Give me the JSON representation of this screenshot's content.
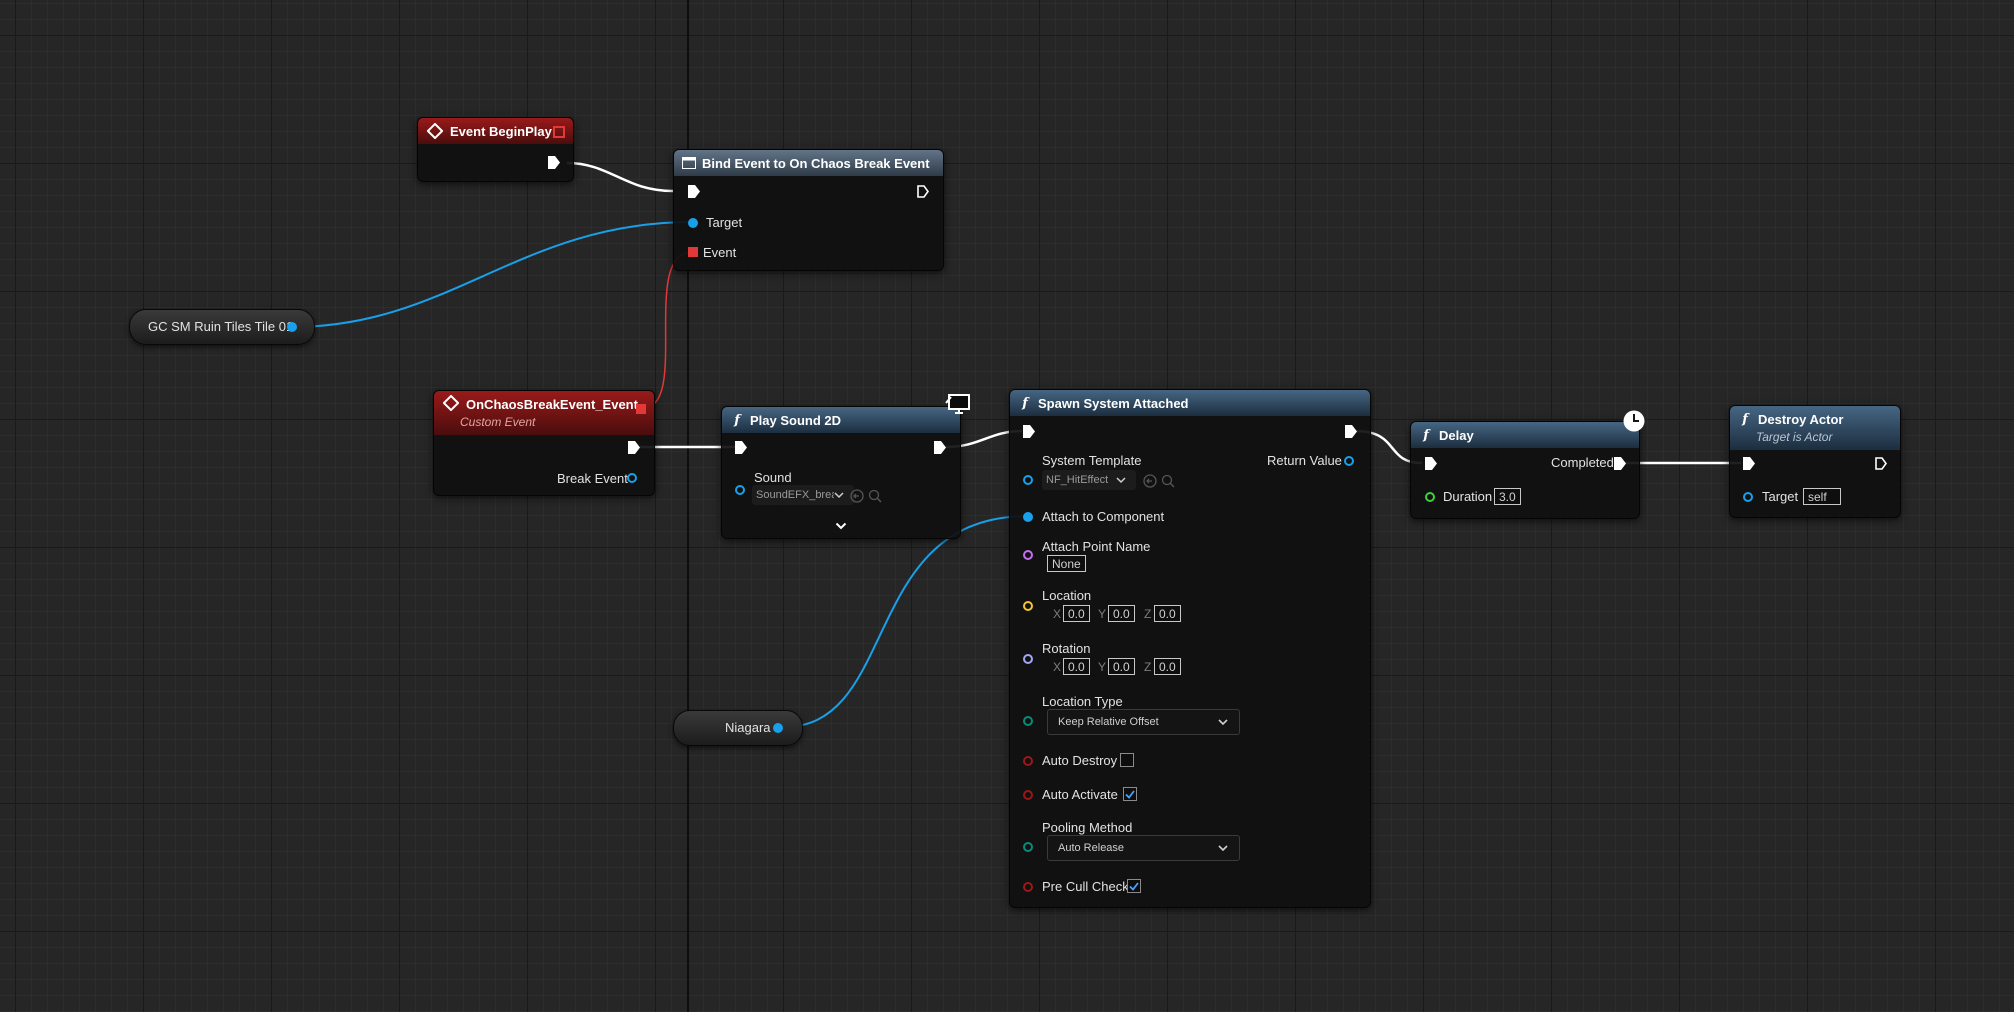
{
  "colors": {
    "exec": "#ffffff",
    "object_pin": "#19a0ea",
    "delegate": "#e23838",
    "name_pin": "#c36ff0",
    "vector_pin": "#f4c431",
    "rotator_pin": "#a4a7f5",
    "enum_pin": "#0a8a78",
    "bool_pin": "#9e1616",
    "float_pin": "#3ed03b"
  },
  "nodes": {
    "begin_play": {
      "title": "Event BeginPlay"
    },
    "bind_event": {
      "title": "Bind Event to On Chaos Break Event",
      "pins": {
        "target": "Target",
        "event": "Event"
      }
    },
    "gc_tile": {
      "label": "GC SM Ruin Tiles Tile 01"
    },
    "chaos_event": {
      "title": "OnChaosBreakEvent_Event",
      "subtitle": "Custom Event",
      "pins": {
        "break_event": "Break Event"
      }
    },
    "play_sound": {
      "title": "Play Sound 2D",
      "pins": {
        "sound": "Sound"
      },
      "sound_value": "SoundEFX_brea"
    },
    "spawn_system": {
      "title": "Spawn System Attached",
      "pins": {
        "system_template": "System Template",
        "return_value": "Return Value",
        "attach_to_component": "Attach to Component",
        "attach_point_name": "Attach Point Name",
        "location": "Location",
        "rotation": "Rotation",
        "location_type": "Location Type",
        "auto_destroy": "Auto Destroy",
        "auto_activate": "Auto Activate",
        "pooling_method": "Pooling Method",
        "pre_cull_check": "Pre Cull Check"
      },
      "values": {
        "system_template": "NF_HitEffect",
        "attach_point_name": "None",
        "location": {
          "x": "0.0",
          "y": "0.0",
          "z": "0.0"
        },
        "rotation": {
          "x": "0.0",
          "y": "0.0",
          "z": "0.0"
        },
        "axis_labels": {
          "x": "X",
          "y": "Y",
          "z": "Z"
        },
        "location_type": "Keep Relative Offset",
        "auto_destroy": false,
        "auto_activate": true,
        "pooling_method": "Auto Release",
        "pre_cull_check": true
      }
    },
    "niagara": {
      "label": "Niagara"
    },
    "delay": {
      "title": "Delay",
      "pins": {
        "completed": "Completed",
        "duration": "Duration"
      },
      "duration_value": "3.0"
    },
    "destroy_actor": {
      "title": "Destroy Actor",
      "subtitle": "Target is Actor",
      "pins": {
        "target": "Target"
      },
      "target_value": "self"
    }
  }
}
